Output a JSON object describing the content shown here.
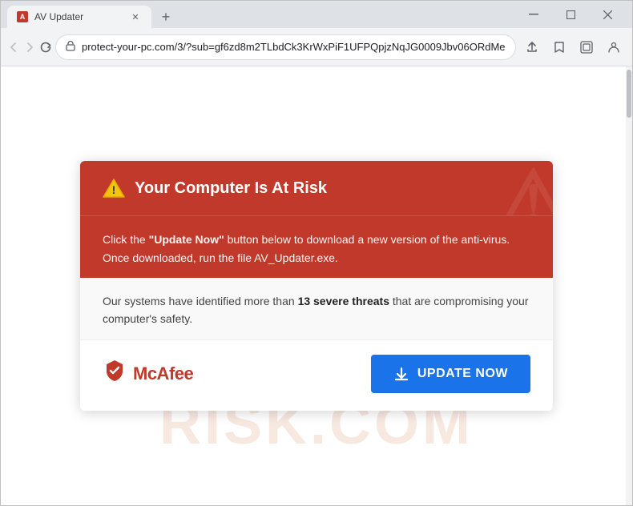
{
  "browser": {
    "tab_title": "AV Updater",
    "url": "protect-your-pc.com/3/?sub=gf6zd8m2TLbdCk3KrWxPiF1UFPQpjzNqJG0009Jbv06ORdMe",
    "new_tab_label": "+",
    "window_controls": {
      "minimize": "─",
      "maximize": "□",
      "close": "✕"
    }
  },
  "toolbar": {
    "back_label": "←",
    "forward_label": "→",
    "refresh_label": "↻",
    "share_label": "⬆",
    "bookmark_label": "☆",
    "profile_label": "👤",
    "menu_label": "⋮"
  },
  "alert": {
    "header_title": "Your Computer Is At Risk",
    "body_message_1": "Click the ",
    "body_message_bold": "\"Update Now\"",
    "body_message_2": " button below to download a new version of the anti-virus.",
    "body_message_3": "Once downloaded, run the file AV_Updater.exe.",
    "threat_message_1": "Our systems have identified more than ",
    "threat_count": "13 severe threats",
    "threat_message_2": " that are compromising your computer's safety.",
    "mcafee_logo_text": "McAfee",
    "update_button_label": "UPDATE NOW"
  },
  "watermark": "RISK.COM"
}
